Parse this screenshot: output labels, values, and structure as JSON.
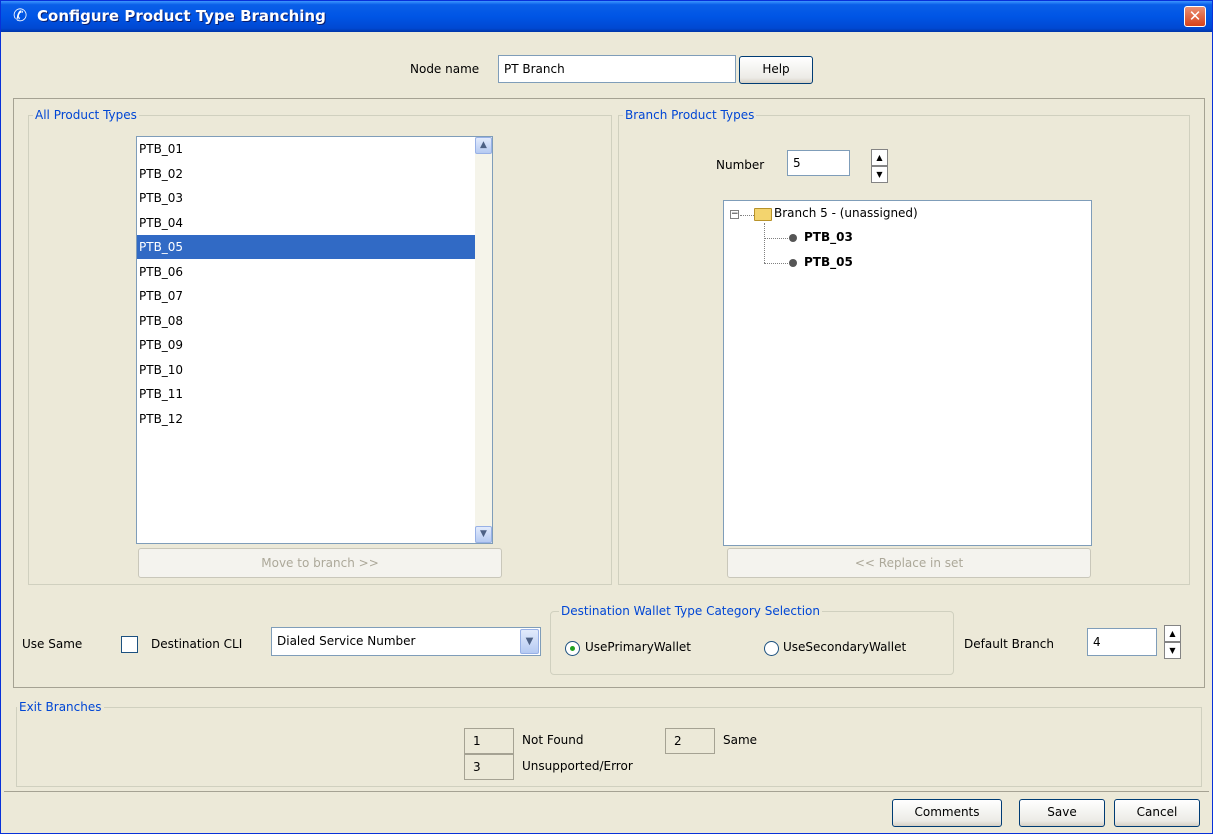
{
  "window": {
    "title": "Configure Product Type Branching"
  },
  "node": {
    "label": "Node name",
    "value": "PT Branch",
    "help_label": "Help"
  },
  "all_product_types": {
    "title": "All Product Types",
    "items": [
      "PTB_01",
      "PTB_02",
      "PTB_03",
      "PTB_04",
      "PTB_05",
      "PTB_06",
      "PTB_07",
      "PTB_08",
      "PTB_09",
      "PTB_10",
      "PTB_11",
      "PTB_12"
    ],
    "selected": "PTB_05",
    "move_label": "Move to branch >>"
  },
  "branch_product_types": {
    "title": "Branch Product Types",
    "number_label": "Number",
    "number_value": "5",
    "tree_root": "Branch 5 - (unassigned)",
    "tree_children": [
      "PTB_03",
      "PTB_05"
    ],
    "replace_label": "<< Replace in set"
  },
  "options": {
    "use_same_label": "Use Same",
    "use_same_checked": false,
    "dest_cli_label": "Destination CLI",
    "dest_cli_value": "Dialed Service Number",
    "wallet_group_title": "Destination Wallet Type Category Selection",
    "primary_label": "UsePrimaryWallet",
    "secondary_label": "UseSecondaryWallet",
    "wallet_selected": "primary",
    "default_branch_label": "Default Branch",
    "default_branch_value": "4"
  },
  "exit_branches": {
    "title": "Exit Branches",
    "items": [
      {
        "num": "1",
        "label": "Not Found"
      },
      {
        "num": "2",
        "label": "Same"
      },
      {
        "num": "3",
        "label": "Unsupported/Error"
      }
    ]
  },
  "footer": {
    "comments_label": "Comments",
    "save_label": "Save",
    "cancel_label": "Cancel"
  },
  "colors": {
    "accent": "#0046D5",
    "selection": "#316AC5",
    "titlebar": "#0055E5",
    "close": "#D8421A"
  }
}
